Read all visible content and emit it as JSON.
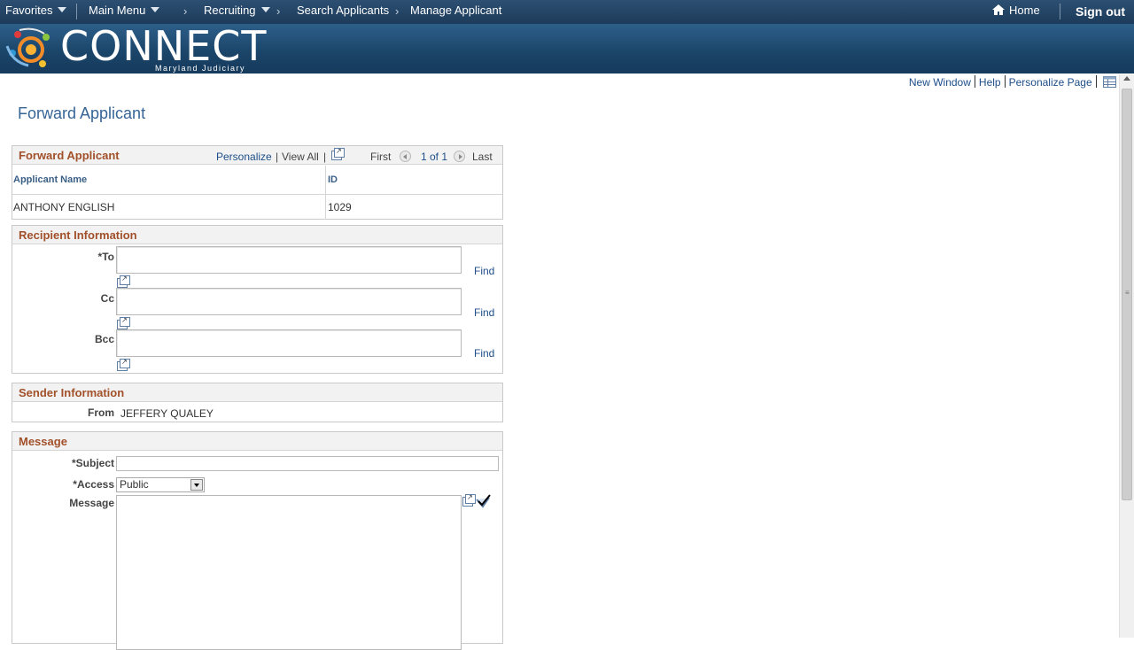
{
  "topnav": {
    "favorites": "Favorites",
    "main_menu": "Main Menu",
    "breadcrumbs": [
      "Recruiting",
      "Search Applicants",
      "Manage Applicant"
    ],
    "home": "Home",
    "signout": "Sign out"
  },
  "banner": {
    "logo_text": "CONNECT",
    "logo_sub": "Maryland Judiciary"
  },
  "pagebar": {
    "new_window": "New Window",
    "help": "Help",
    "personalize_page": "Personalize Page"
  },
  "page_title": "Forward Applicant",
  "grid": {
    "title": "Forward Applicant",
    "personalize": "Personalize",
    "view_all": "View All",
    "first": "First",
    "count": "1 of 1",
    "last": "Last",
    "columns": [
      "Applicant Name",
      "ID"
    ],
    "rows": [
      [
        "ANTHONY ENGLISH",
        "1029"
      ]
    ]
  },
  "recipient": {
    "title": "Recipient Information",
    "to_label": "*To",
    "cc_label": "Cc",
    "bcc_label": "Bcc",
    "find": "Find",
    "to_value": "",
    "cc_value": "",
    "bcc_value": ""
  },
  "sender": {
    "title": "Sender Information",
    "from_label": "From",
    "from_value": "JEFFERY QUALEY"
  },
  "message": {
    "title": "Message",
    "subject_label": "*Subject",
    "subject_value": "",
    "access_label": "*Access",
    "access_value": "Public",
    "message_label": "Message",
    "message_value": ""
  },
  "colors": {
    "section_title": "#a1502a",
    "link": "#1d4e89",
    "topbar": "#1d3b5a"
  }
}
